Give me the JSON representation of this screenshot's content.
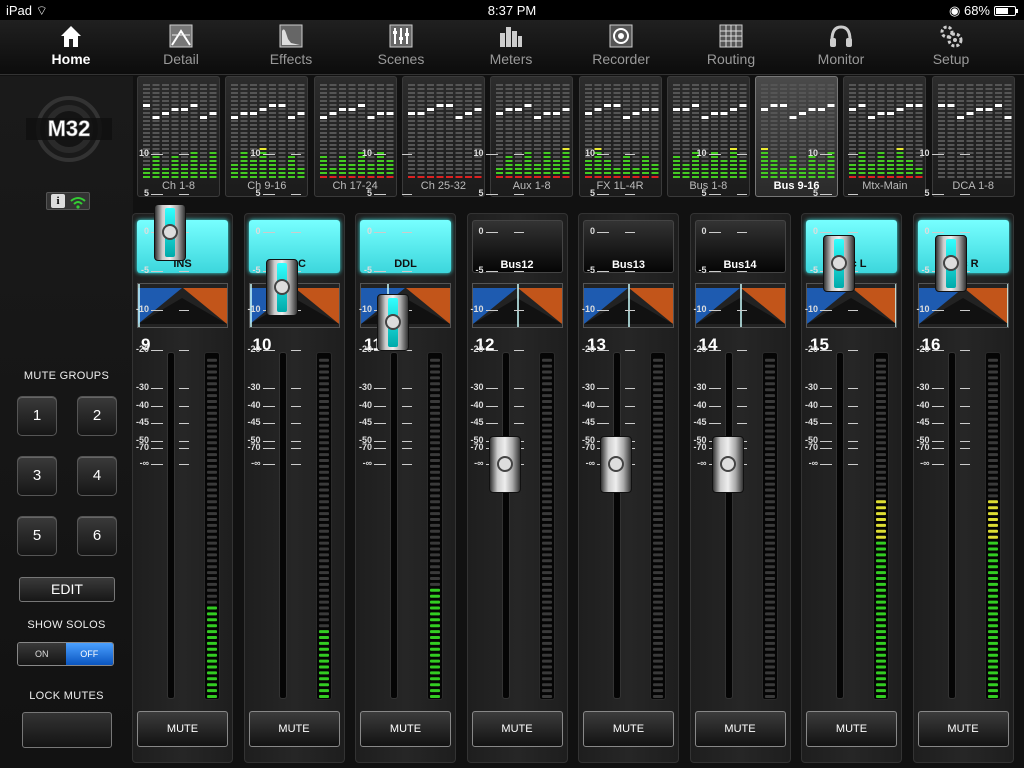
{
  "status": {
    "device": "iPad",
    "time": "8:37 PM",
    "battery": "68%",
    "battery_level": 0.68
  },
  "nav": [
    {
      "label": "Home",
      "icon": "home-icon",
      "active": true
    },
    {
      "label": "Detail",
      "icon": "detail-icon"
    },
    {
      "label": "Effects",
      "icon": "effects-icon"
    },
    {
      "label": "Scenes",
      "icon": "scenes-icon"
    },
    {
      "label": "Meters",
      "icon": "meters-icon"
    },
    {
      "label": "Recorder",
      "icon": "recorder-icon"
    },
    {
      "label": "Routing",
      "icon": "routing-icon"
    },
    {
      "label": "Monitor",
      "icon": "headphones-icon"
    },
    {
      "label": "Setup",
      "icon": "gear-icon"
    }
  ],
  "left": {
    "logo": "M32",
    "info_label": "i",
    "mute_groups_label": "MUTE GROUPS",
    "mute_groups": [
      "1",
      "2",
      "3",
      "4",
      "5",
      "6"
    ],
    "edit_label": "EDIT",
    "show_solos_label": "SHOW SOLOS",
    "toggle_on": "ON",
    "toggle_off": "OFF",
    "show_solos_state": "OFF",
    "lock_mutes_label": "LOCK MUTES"
  },
  "overview": [
    {
      "label": "Ch 1-8"
    },
    {
      "label": "Ch 9-16"
    },
    {
      "label": "Ch 17-24"
    },
    {
      "label": "Ch 25-32"
    },
    {
      "label": "Aux 1-8"
    },
    {
      "label": "FX 1L-4R"
    },
    {
      "label": "Bus 1-8"
    },
    {
      "label": "Bus 9-16",
      "active": true
    },
    {
      "label": "Mtx-Main"
    },
    {
      "label": "DCA 1-8"
    }
  ],
  "scale": [
    "10",
    "5",
    "0",
    "-5",
    "-10",
    "-20",
    "-30",
    "-40",
    "-45",
    "-50",
    "-70",
    "-∞"
  ],
  "mute_label": "MUTE",
  "channels": [
    {
      "number": "9",
      "name": "INS",
      "lit": true,
      "pan": 0.0,
      "fader_db": 0,
      "meter": 0.27,
      "meter_color": "green"
    },
    {
      "number": "10",
      "name": "VOC",
      "lit": true,
      "pan": 0.0,
      "fader_db": -7,
      "meter": 0.21,
      "meter_color": "green"
    },
    {
      "number": "11",
      "name": "DDL",
      "lit": true,
      "pan": 0.3,
      "fader_db": -13,
      "meter": 0.33,
      "meter_color": "green"
    },
    {
      "number": "12",
      "name": "Bus12",
      "lit": false,
      "pan": 0.5,
      "fader_db": -80,
      "meter": 0,
      "meter_color": "green"
    },
    {
      "number": "13",
      "name": "Bus13",
      "lit": false,
      "pan": 0.5,
      "fader_db": -80,
      "meter": 0,
      "meter_color": "green"
    },
    {
      "number": "14",
      "name": "Bus14",
      "lit": false,
      "pan": 0.5,
      "fader_db": -80,
      "meter": 0,
      "meter_color": "green"
    },
    {
      "number": "15",
      "name": "Rec L",
      "lit": true,
      "pan": 1.0,
      "fader_db": -4,
      "meter": 0.58,
      "meter_color": "yellow"
    },
    {
      "number": "16",
      "name": "Rec R",
      "lit": true,
      "pan": 1.0,
      "fader_db": -4,
      "meter": 0.58,
      "meter_color": "yellow"
    }
  ]
}
